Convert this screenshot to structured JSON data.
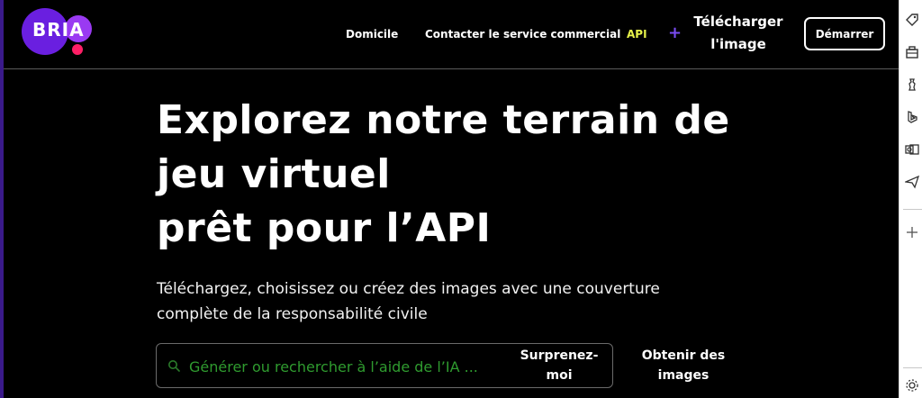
{
  "brand": {
    "logo_text": "BRIA"
  },
  "nav": {
    "home": "Domicile",
    "sales": "Contacter le service commercial",
    "api": "API",
    "download_line1": "Télécharger",
    "download_line2": "l'image",
    "start_button": "Démarrer"
  },
  "hero": {
    "title_line1": "Explorez notre terrain de",
    "title_line2": "jeu virtuel",
    "title_line3": "prêt pour l’API",
    "subtitle_line1": "Téléchargez, choisissez ou créez des images avec une couverture",
    "subtitle_line2": "complète de la responsabilité civile"
  },
  "search": {
    "placeholder": "Générer ou rechercher à l’aide de l’IA ...",
    "surprise_line1": "Surprenez-",
    "surprise_line2": "moi",
    "get_images_line1": "Obtenir des",
    "get_images_line2": "images"
  },
  "colors": {
    "accent_purple": "#6a1fe0",
    "api_yellow": "#e7f24a",
    "placeholder_green": "#2f9b2f"
  },
  "sidebar": {
    "icons": [
      "tag-icon",
      "toolbox-icon",
      "chess-icon",
      "bing-icon",
      "outlook-icon",
      "send-icon",
      "add-icon",
      "settings-icon"
    ]
  }
}
